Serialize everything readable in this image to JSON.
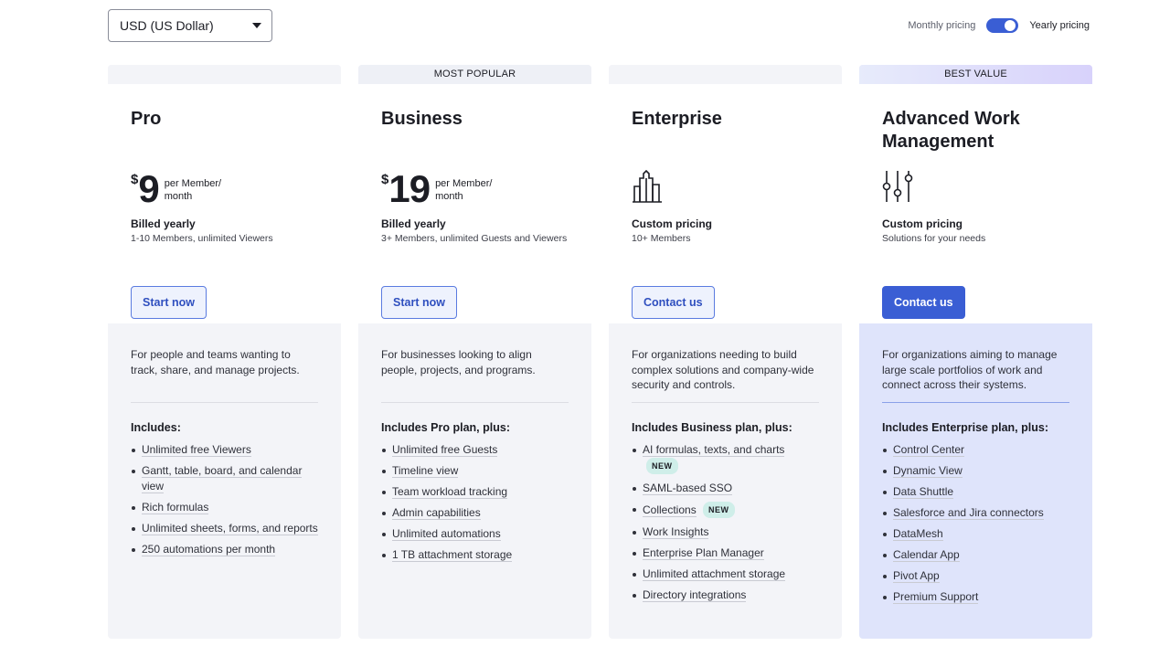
{
  "currency": {
    "selected": "USD (US Dollar)"
  },
  "toggle": {
    "monthly_label": "Monthly pricing",
    "yearly_label": "Yearly pricing",
    "state": "yearly"
  },
  "plans": [
    {
      "ribbon": "",
      "name": "Pro",
      "price_symbol": "$",
      "price": "9",
      "price_unit_1": "per Member/",
      "price_unit_2": "month",
      "billing_title": "Billed yearly",
      "billing_sub": "1-10 Members, unlimited Viewers",
      "cta": "Start now",
      "description": "For people and teams wanting to track, share, and manage projects.",
      "includes_title": "Includes:",
      "features": [
        "Unlimited free Viewers",
        "Gantt, table, board, and calendar view",
        "Rich formulas",
        "Unlimited sheets, forms, and reports",
        "250 automations per month"
      ]
    },
    {
      "ribbon": "MOST POPULAR",
      "name": "Business",
      "price_symbol": "$",
      "price": "19",
      "price_unit_1": "per Member/",
      "price_unit_2": "month",
      "billing_title": "Billed yearly",
      "billing_sub": "3+ Members, unlimited Guests and Viewers",
      "cta": "Start now",
      "description": "For businesses looking to align people, projects, and programs.",
      "includes_title": "Includes Pro plan, plus:",
      "features": [
        "Unlimited free Guests",
        "Timeline view",
        "Team workload tracking",
        "Admin capabilities",
        "Unlimited automations",
        "1 TB attachment storage"
      ]
    },
    {
      "ribbon": "",
      "name": "Enterprise",
      "icon": "building-icon",
      "billing_title": "Custom pricing",
      "billing_sub": "10+ Members",
      "cta": "Contact us",
      "description": "For organizations needing to build complex solutions and company-wide security and controls.",
      "includes_title": "Includes Business plan, plus:",
      "features": [
        "AI formulas, texts, and charts",
        "SAML-based SSO",
        "Collections",
        "Work Insights",
        "Enterprise Plan Manager",
        "Unlimited attachment storage",
        "Directory integrations"
      ],
      "new_badge": "NEW"
    },
    {
      "ribbon": "BEST VALUE",
      "name": "Advanced Work Management",
      "icon": "sliders-icon",
      "billing_title": "Custom pricing",
      "billing_sub": "Solutions for your needs",
      "cta": "Contact us",
      "description": "For organizations aiming to manage large scale portfolios of work and connect across their systems.",
      "includes_title": "Includes Enterprise plan, plus:",
      "features": [
        "Control Center",
        "Dynamic View",
        "Data Shuttle",
        "Salesforce and Jira connectors",
        "DataMesh",
        "Calendar App",
        "Pivot App",
        "Premium Support"
      ]
    }
  ],
  "colors": {
    "accent": "#3a5ed4",
    "card_bg": "#f3f4f8",
    "accent_card_bg": "#dfe4fb",
    "badge_bg": "#cfeee9"
  }
}
